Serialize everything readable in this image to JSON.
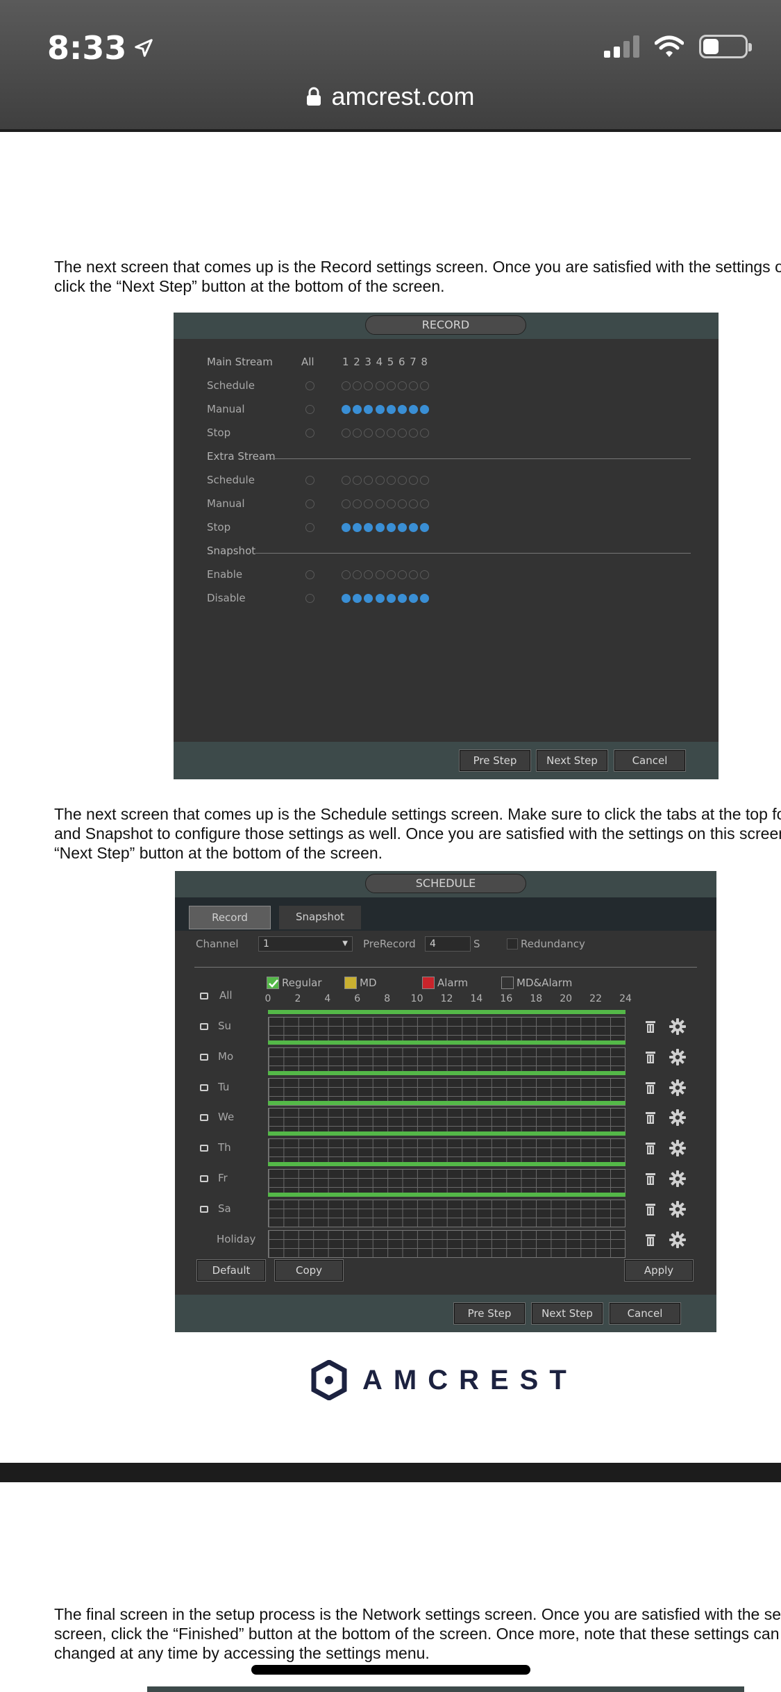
{
  "status_bar": {
    "time": "8:33",
    "url": "amcrest.com"
  },
  "article": {
    "para1": [
      "The next screen that comes up is the Record settings screen. Once you are satisfied with the settings on thi",
      "click the “Next Step” button at the bottom of the screen."
    ],
    "para2": [
      "The next screen that comes up is the Schedule settings screen. Make sure to click the tabs at the top for Re",
      "and Snapshot to configure those settings as well. Once you are satisfied with the settings on this screen, cli",
      "“Next Step” button at the bottom of the screen."
    ],
    "para3": [
      "The final screen in the setup process is the Network settings screen. Once you are satisfied with the setting",
      "screen, click the “Finished” button at the bottom of the screen. Once more, note that these settings can be",
      "changed at any time by accessing the settings menu."
    ]
  },
  "record": {
    "title": "RECORD",
    "col_all": "All",
    "channels": [
      "1",
      "2",
      "3",
      "4",
      "5",
      "6",
      "7",
      "8"
    ],
    "sections": [
      {
        "heading": "Main Stream",
        "rows": [
          {
            "label": "Schedule",
            "selected": false
          },
          {
            "label": "Manual",
            "selected": true
          },
          {
            "label": "Stop",
            "selected": false
          }
        ]
      },
      {
        "heading": "Extra Stream",
        "rows": [
          {
            "label": "Schedule",
            "selected": false
          },
          {
            "label": "Manual",
            "selected": false
          },
          {
            "label": "Stop",
            "selected": true
          }
        ]
      },
      {
        "heading": "Snapshot",
        "rows": [
          {
            "label": "Enable",
            "selected": false
          },
          {
            "label": "Disable",
            "selected": true
          }
        ]
      }
    ],
    "buttons": {
      "pre": "Pre Step",
      "next": "Next Step",
      "cancel": "Cancel"
    }
  },
  "schedule": {
    "title": "SCHEDULE",
    "tabs": [
      "Record",
      "Snapshot"
    ],
    "channel_label": "Channel",
    "channel_value": "1",
    "prerecord_label": "PreRecord",
    "prerecord_value": "4",
    "prerecord_unit": "S",
    "redundancy_label": "Redundancy",
    "legend": [
      {
        "label": "Regular",
        "color": "#54b848"
      },
      {
        "label": "MD",
        "color": "#c9b030"
      },
      {
        "label": "Alarm",
        "color": "#c8242b"
      },
      {
        "label": "MD&Alarm",
        "color": "#333333"
      }
    ],
    "all_label": "All",
    "hours": [
      "0",
      "2",
      "4",
      "6",
      "8",
      "10",
      "12",
      "14",
      "16",
      "18",
      "20",
      "22",
      "24"
    ],
    "days": [
      "Su",
      "Mo",
      "Tu",
      "We",
      "Th",
      "Fr",
      "Sa",
      "Holiday"
    ],
    "buttons": {
      "default": "Default",
      "copy": "Copy",
      "apply": "Apply",
      "pre": "Pre Step",
      "next": "Next Step",
      "cancel": "Cancel"
    }
  },
  "brand": {
    "name": "AMCREST",
    "color": "#1c2240"
  },
  "colors": {
    "selected_dot": "#3a8fd5",
    "panel_bg": "#333333",
    "header_bg": "#3d4a4a"
  }
}
